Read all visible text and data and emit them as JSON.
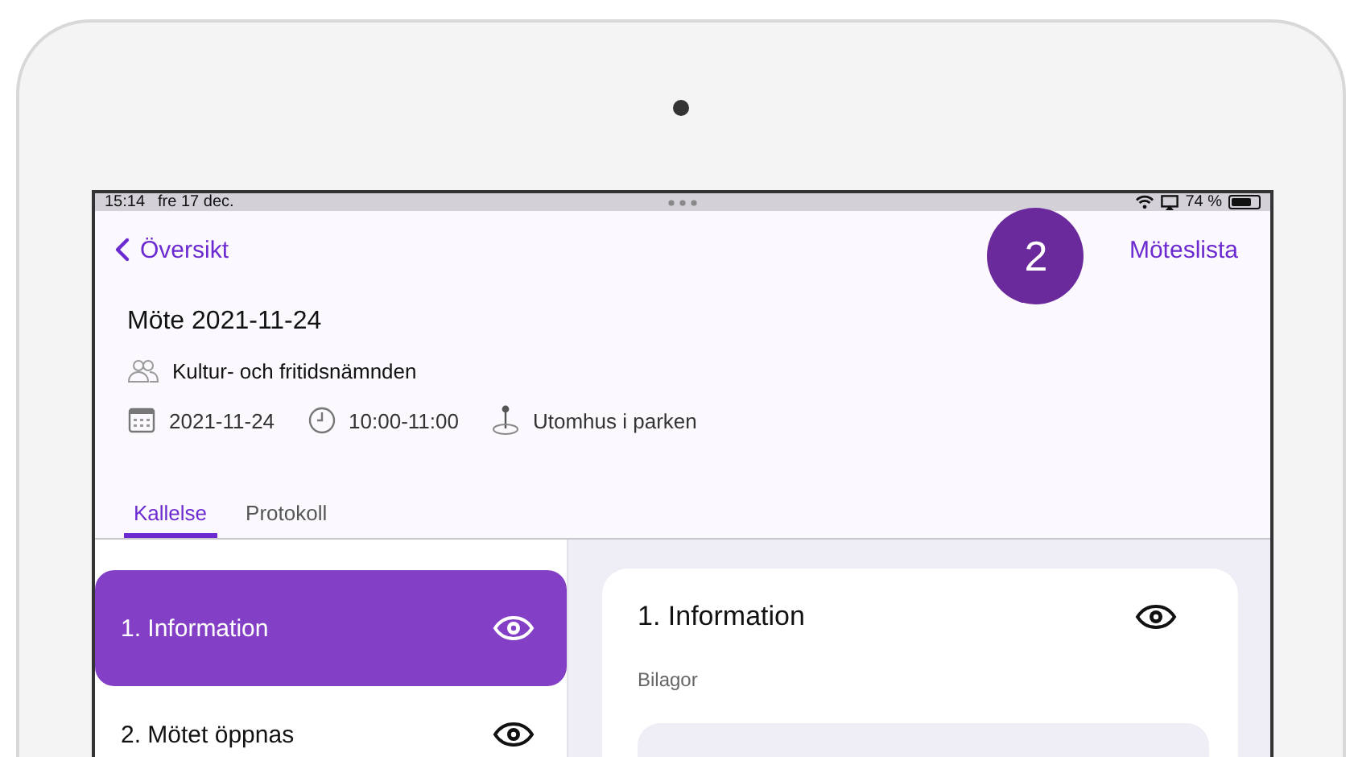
{
  "status_bar": {
    "time": "15:14",
    "date": "fre 17 dec.",
    "battery_text": "74 %",
    "level": 0.74
  },
  "nav": {
    "back_label": "Översikt",
    "step_badge": "2",
    "right_link": "Möteslista"
  },
  "meeting": {
    "title": "Möte 2021-11-24",
    "committee": "Kultur- och fritidsnämnden",
    "date": "2021-11-24",
    "time": "10:00-11:00",
    "location": "Utomhus i parken"
  },
  "tabs": [
    {
      "label": "Kallelse",
      "selected": true
    },
    {
      "label": "Protokoll",
      "selected": false
    }
  ],
  "agenda_items": [
    {
      "label": "1. Information",
      "selected": true
    },
    {
      "label": "2. Mötet öppnas",
      "selected": false
    }
  ],
  "detail": {
    "title": "1. Information",
    "section_label": "Bilagor"
  }
}
